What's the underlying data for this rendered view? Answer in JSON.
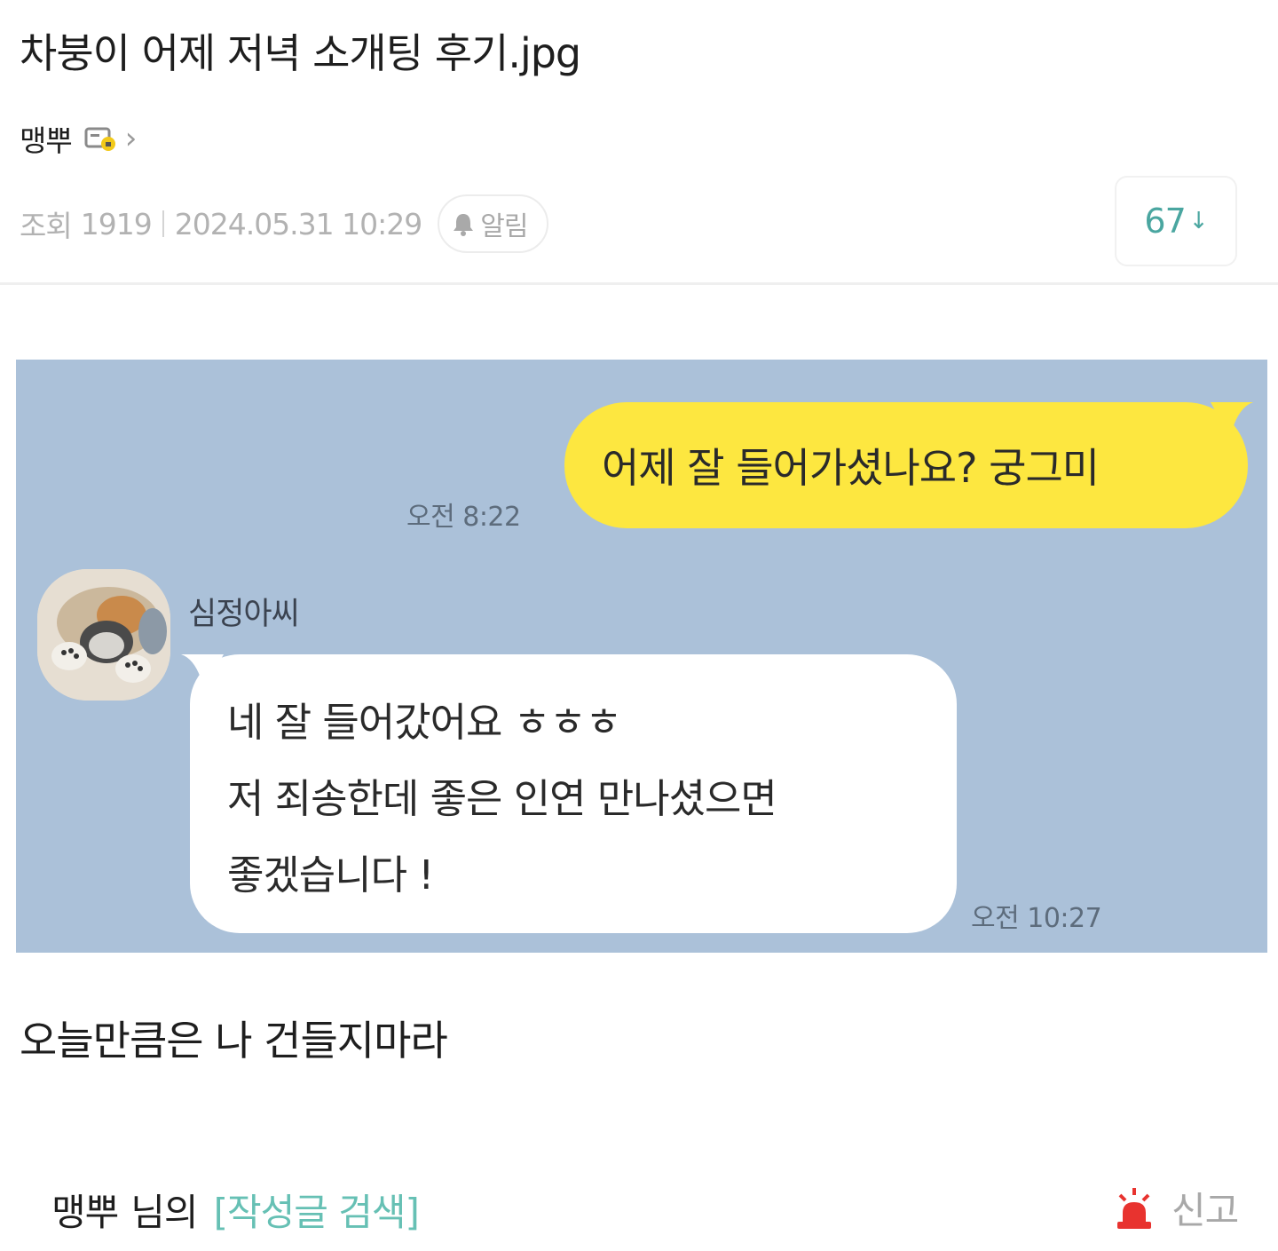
{
  "post": {
    "title": "차붕이 어제 저녁 소개팅 후기.jpg",
    "author": "맹뿌",
    "author_badge_icon": "member-badge-icon",
    "meta": {
      "views_label": "조회",
      "views": "1919",
      "datetime": "2024.05.31 10:29",
      "alarm_label": "알림"
    },
    "comment_count": "67",
    "comment_arrow": "↓"
  },
  "chat": {
    "background_color": "#abc1d9",
    "my_bubble_color": "#fde740",
    "my_message": "어제 잘 들어가셨나요? 궁그미",
    "my_time": "오전 8:22",
    "sender_name": "심정아씨",
    "their_message_lines": [
      "네 잘 들어갔어요 ㅎㅎㅎ",
      "저 죄송한데 좋은 인연 만나셨으면",
      "좋겠습니다 !"
    ],
    "their_time": "오전 10:27"
  },
  "body_text": "오늘만큼은 나 건들지마라",
  "footer": {
    "author": "맹뿌",
    "suffix": "님의",
    "search_link": "[작성글 검색]",
    "report_label": "신고",
    "accent_color": "#66c0b4",
    "report_icon_color": "#e8332f"
  }
}
